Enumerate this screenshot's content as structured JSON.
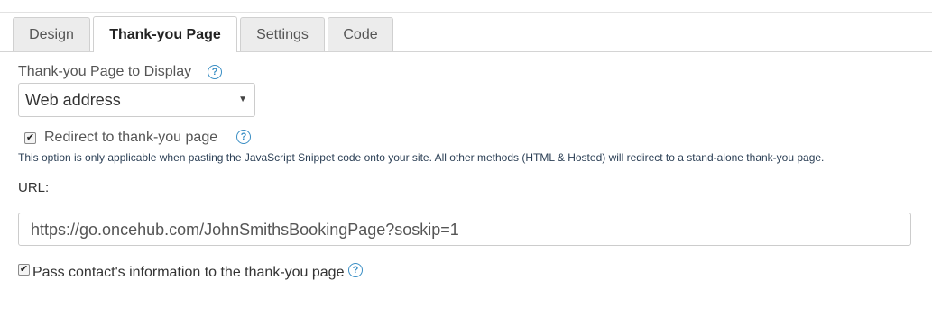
{
  "tabs": [
    {
      "label": "Design",
      "active": false
    },
    {
      "label": "Thank-you Page",
      "active": true
    },
    {
      "label": "Settings",
      "active": false
    },
    {
      "label": "Code",
      "active": false
    }
  ],
  "thank_you_display": {
    "label": "Thank-you Page to Display",
    "selected": "Web address"
  },
  "redirect": {
    "checked": true,
    "label": "Redirect to thank-you page",
    "note": "This option is only applicable when pasting the JavaScript Snippet code onto your site. All other methods (HTML & Hosted) will redirect to a stand-alone thank-you page."
  },
  "url": {
    "label": "URL:",
    "value": "https://go.oncehub.com/JohnSmithsBookingPage?soskip=1"
  },
  "pass_contact": {
    "checked": true,
    "label": "Pass contact's information to the thank-you page"
  },
  "icons": {
    "help": "help-question-circle-icon",
    "checkmark": "✔",
    "caret": "▼"
  },
  "colors": {
    "help_icon": "#3a8ec4",
    "note_text": "#2b3f55",
    "tab_inactive_bg": "#ececec"
  }
}
